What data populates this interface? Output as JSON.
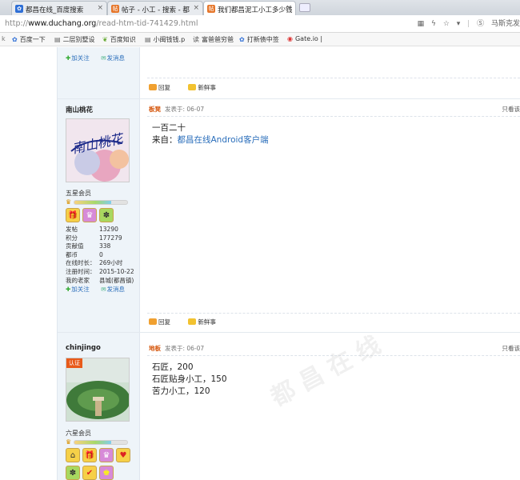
{
  "browser": {
    "tabs": [
      {
        "title": "都昌在线_百度搜索",
        "favicon": "baidu-paw-icon",
        "color": "#2f6fd6"
      },
      {
        "title": "帖子 - 小工 - 搜索 - 都",
        "favicon": "forum-icon",
        "color": "#e6762a"
      },
      {
        "title": "我们都昌泥工小工多少钱",
        "favicon": "forum-icon",
        "color": "#e6762a"
      }
    ],
    "url_prefix": "http://",
    "url_host": "www.duchang.org",
    "url_path": "/read-htm-tid-741429.html",
    "right_label": "马斯克发",
    "bookmarks": [
      {
        "label": "百度一下",
        "icon": "baidu-paw-icon"
      },
      {
        "label": "二层别墅设",
        "icon": "page-icon"
      },
      {
        "label": "百度知识",
        "icon": "leaf-icon"
      },
      {
        "label": "小闽钱钱.p",
        "icon": "page-icon"
      },
      {
        "label": "富爸爸穷爸",
        "icon": "reading-icon"
      },
      {
        "label": "打新债中签",
        "icon": "baidu-paw-icon"
      },
      {
        "label": "Gate.io |",
        "icon": "gate-icon"
      }
    ]
  },
  "posts": [
    {
      "user": {
        "profile_actions": {
          "follow": "加关注",
          "message": "发消息"
        }
      },
      "actions": {
        "reply": "回复",
        "news": "新鲜事"
      }
    },
    {
      "user": {
        "name": "南山桃花",
        "grade": "五星会员",
        "signature_text": "南山桃花",
        "stats": [
          {
            "k": "发帖",
            "v": "13290"
          },
          {
            "k": "积分",
            "v": "177279"
          },
          {
            "k": "贡献值",
            "v": "338"
          },
          {
            "k": "都币",
            "v": "0"
          },
          {
            "k": "在线时长：",
            "v": "269小时"
          },
          {
            "k": "注册时间：",
            "v": "2015-10-22"
          },
          {
            "k": "我的老家",
            "v": "县城(都昌镇)"
          }
        ],
        "profile_actions": {
          "follow": "加关注",
          "message": "发消息"
        }
      },
      "category": "板凳",
      "posted": "发表于: 06-07",
      "view_only": "只看该",
      "content_line1": "一百二十",
      "content_prefix": "来自：",
      "content_link": "都昌在线Android客户端",
      "actions": {
        "reply": "回复",
        "news": "新鲜事"
      }
    },
    {
      "user": {
        "name": "chinjingo",
        "badge": "认证",
        "grade": "六星会员"
      },
      "category": "地板",
      "posted": "发表于: 06-07",
      "view_only": "只看该",
      "content": [
        "石匠，200",
        "石匠贴身小工，150",
        "苦力小工，120"
      ]
    }
  ],
  "watermark": "都昌在线"
}
